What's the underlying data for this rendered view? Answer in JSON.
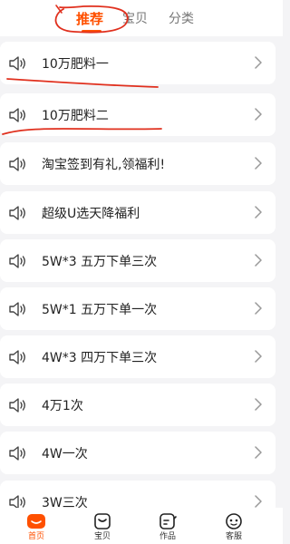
{
  "top_tabs": [
    {
      "label": "推荐",
      "active": true
    },
    {
      "label": "宝贝",
      "active": false
    },
    {
      "label": "分类",
      "active": false
    }
  ],
  "list_items": [
    {
      "label": "10万肥料一",
      "icon": "speaker-icon"
    },
    {
      "label": "10万肥料二",
      "icon": "speaker-icon"
    },
    {
      "label": "淘宝签到有礼,领福利!",
      "icon": "speaker-icon"
    },
    {
      "label": "超级U选天降福利",
      "icon": "speaker-icon"
    },
    {
      "label": "5W*3 五万下单三次",
      "icon": "speaker-icon"
    },
    {
      "label": "5W*1 五万下单一次",
      "icon": "speaker-icon"
    },
    {
      "label": "4W*3 四万下单三次",
      "icon": "speaker-icon"
    },
    {
      "label": "4万1次",
      "icon": "speaker-icon"
    },
    {
      "label": "4W一次",
      "icon": "speaker-icon"
    },
    {
      "label": "3W三次",
      "icon": "speaker-icon"
    }
  ],
  "bottom_nav": [
    {
      "label": "首页",
      "icon": "home-icon",
      "active": true
    },
    {
      "label": "宝贝",
      "icon": "bag-icon",
      "active": false
    },
    {
      "label": "作品",
      "icon": "works-icon",
      "active": false
    },
    {
      "label": "客服",
      "icon": "service-icon",
      "active": false
    }
  ],
  "colors": {
    "accent": "#ff5000",
    "annotation": "#e0301e",
    "background": "#f4f4f6"
  }
}
